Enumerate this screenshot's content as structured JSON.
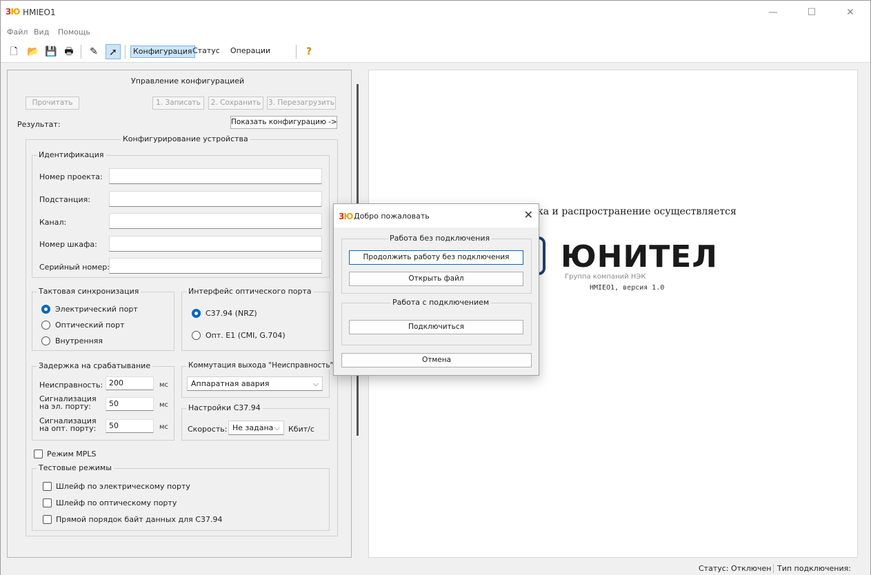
{
  "window": {
    "title": "HMIEO1",
    "icon_text_a": "3",
    "icon_text_b": "Ю"
  },
  "menu": {
    "items": [
      "Файл",
      "Вид",
      "Помощь"
    ]
  },
  "toolbar": {
    "tabs": [
      "Конфигурация",
      "Статус",
      "Операции"
    ],
    "active_tab": "Конфигурация"
  },
  "config_control": {
    "title": "Управление конфигурацией",
    "read_button": "Прочитать",
    "write_button": "1. Записать",
    "save_button": "2. Сохранить",
    "reboot_button": "3. Перезагрузить",
    "result_label": "Результат:",
    "show_config_button": "Показать конфигурацию ->"
  },
  "device_config": {
    "title": "Конфигурирование устройства",
    "identification": {
      "title": "Идентификация",
      "fields": [
        {
          "label": "Номер проекта:",
          "value": ""
        },
        {
          "label": "Подстанция:",
          "value": ""
        },
        {
          "label": "Канал:",
          "value": ""
        },
        {
          "label": "Номер шкафа:",
          "value": ""
        },
        {
          "label": "Серийный номер:",
          "value": ""
        }
      ]
    },
    "clock_sync": {
      "title": "Тактовая синхронизация",
      "options": [
        "Электрический порт",
        "Оптический порт",
        "Внутренняя"
      ],
      "selected": "Электрический порт"
    },
    "optical_interface": {
      "title": "Интерфейс оптического порта",
      "options": [
        "C37.94 (NRZ)",
        "Опт. E1 (CMI, G.704)"
      ],
      "selected": "C37.94 (NRZ)"
    },
    "trip_delay": {
      "title": "Задержка на срабатывание",
      "rows": [
        {
          "label": "Неисправность:",
          "value": "200",
          "unit": "мс"
        },
        {
          "label": "Сигнализация на эл. порту:",
          "value": "50",
          "unit": "мс"
        },
        {
          "label": "Сигнализация на опт. порту:",
          "value": "50",
          "unit": "мс"
        }
      ]
    },
    "fault_output": {
      "title": "Коммутация выхода \"Неисправность\"",
      "value": "Аппаратная авария"
    },
    "c3794_settings": {
      "title": "Настройки C37.94",
      "speed_label": "Скорость:",
      "speed_value": "Не задана",
      "speed_unit": "Кбит/с"
    },
    "mpls": {
      "label": "Режим MPLS",
      "checked": false
    },
    "test_modes": {
      "title": "Тестовые режимы",
      "options": [
        "Шлейф по электрическому порту",
        "Шлейф по оптическому порту",
        "Прямой порядок байт данных для C37.94"
      ]
    }
  },
  "about": {
    "text": "ка и распространение осуществляется",
    "logo": "ЮНИТЕЛ",
    "logo_sub": "Группа компаний НЭК",
    "version": "HMIEO1, версия 1.0",
    "brand_color": "#1f3f6e"
  },
  "welcome_dialog": {
    "title": "Добро пожаловать",
    "offline_group": "Работа без подключения",
    "continue_offline_button": "Продолжить работу без подключения",
    "open_file_button": "Открыть файл",
    "online_group": "Работа с подключением",
    "connect_button": "Подключиться",
    "cancel_button": "Отмена"
  },
  "status": {
    "status_text": "Статус: Отключен",
    "connection_type": "Тип подключения:"
  },
  "colors": {
    "accent": "#0067c0",
    "selection": "#cce4f7"
  }
}
